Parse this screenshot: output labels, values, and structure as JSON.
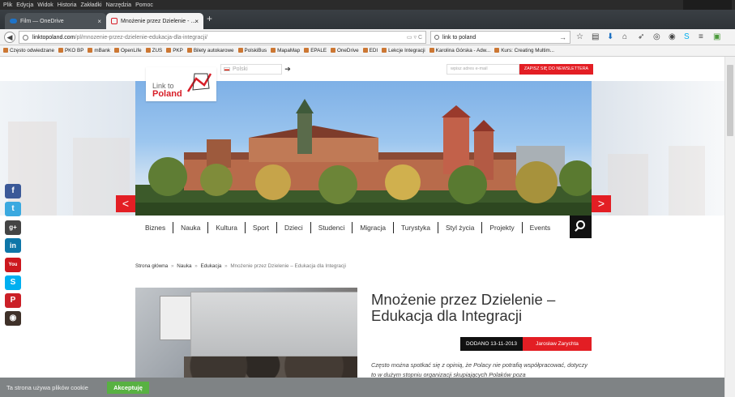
{
  "menubar": {
    "items": [
      "Plik",
      "Edycja",
      "Widok",
      "Historia",
      "Zakładki",
      "Narzędzia",
      "Pomoc"
    ]
  },
  "tabs": [
    {
      "label": "Film — OneDrive",
      "active": false
    },
    {
      "label": "Mnożenie przez Dzielenie - ...",
      "active": true
    }
  ],
  "tab_close": "×",
  "new_tab": "+",
  "navigation": {
    "back": "◀",
    "url_domain": "linktopoland.com",
    "url_path": "/pl/mnozenie-przez-dzielenie-edukacja-dla-integracji/",
    "url_controls": "▭ ▿ C",
    "search_value": "link to poland",
    "search_go": "→",
    "toolbar_icons": [
      "☆",
      "▤",
      "⬇",
      "⌂",
      "➶",
      "◎",
      "◉",
      "S",
      "≡",
      "▣"
    ]
  },
  "bookmarks": [
    "Często odwiedzane",
    "PKO BP",
    "mBank",
    "OpenLife",
    "ZUS",
    "PKP",
    "Bilety autokarowe",
    "PolskiBus",
    "MapaMap",
    "EPALE",
    "OneDrive",
    "EDI",
    "Lekcje Integracji",
    "Karolina Górska - Adw...",
    "Kurs: Creating Multim..."
  ],
  "site": {
    "language_value": "Polski",
    "language_go": "➔",
    "email_placeholder": "wpisz adres e-mail",
    "newsletter_button": "ZAPISZ SIĘ DO NEWSLETTERA",
    "logo_line1": "Link to",
    "logo_line2": "Poland",
    "slider_prev": "<",
    "slider_next": ">"
  },
  "nav_items": [
    "Biznes",
    "Nauka",
    "Kultura",
    "Sport",
    "Dzieci",
    "Studenci",
    "Migracja",
    "Turystyka",
    "Styl życia",
    "Projekty",
    "Events"
  ],
  "social": [
    {
      "name": "facebook",
      "glyph": "f",
      "color": "#3b5998"
    },
    {
      "name": "twitter",
      "glyph": "t",
      "color": "#3aa9e0"
    },
    {
      "name": "google-plus",
      "glyph": "g+",
      "color": "#444444"
    },
    {
      "name": "linkedin",
      "glyph": "in",
      "color": "#0e76a8"
    },
    {
      "name": "youtube",
      "glyph": "You",
      "color": "#cc181e"
    },
    {
      "name": "skype",
      "glyph": "S",
      "color": "#00aff0"
    },
    {
      "name": "pinterest",
      "glyph": "P",
      "color": "#cb2027"
    },
    {
      "name": "instagram",
      "glyph": "◉",
      "color": "#3f3129"
    }
  ],
  "breadcrumb": {
    "home": "Strona główna",
    "sep": "»",
    "level1": "Nauka",
    "level2": "Edukacja",
    "current": "Mnożenie przez Dzielenie – Edukacja dla Integracji"
  },
  "article": {
    "title": "Mnożenie przez Dzielenie – Edukacja dla Integracji",
    "date_label": "DODANO 13-11-2013",
    "author": "Jarosław Zarychta",
    "excerpt": "Często można spotkać się z opinią, że Polacy nie potrafią współpracować, dotyczy to w dużym stopniu organizacji skupiających Polaków poza"
  },
  "cookie_bar": {
    "text": "Ta strona używa plików cookie",
    "button": "Akceptuję"
  },
  "colors": {
    "accent_red": "#e31e24",
    "cookie_green": "#58b142"
  }
}
